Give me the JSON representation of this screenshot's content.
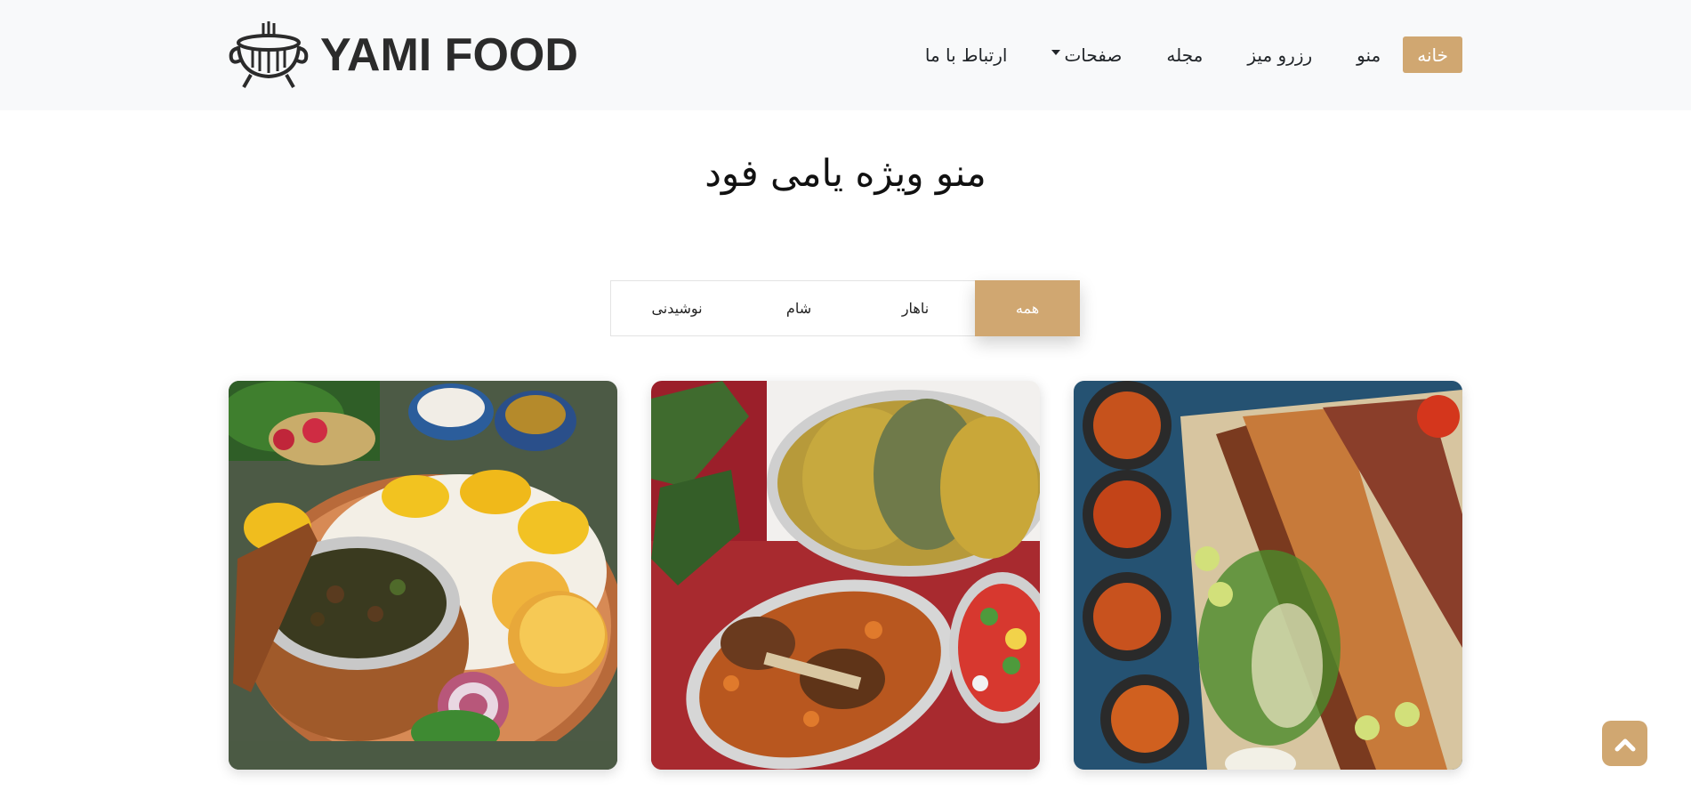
{
  "brand": {
    "name": "YAMI FOOD"
  },
  "nav": {
    "items": [
      {
        "label": "خانه",
        "active": true
      },
      {
        "label": "منو"
      },
      {
        "label": "رزرو میز"
      },
      {
        "label": "مجله"
      },
      {
        "label": "صفحات",
        "dropdown": true
      },
      {
        "label": "ارتباط با ما"
      }
    ]
  },
  "menu_section": {
    "title": "منو ویژه یامی فود",
    "filters": [
      {
        "label": "همه",
        "active": true
      },
      {
        "label": "ناهار"
      },
      {
        "label": "شام"
      },
      {
        "label": "نوشیدنی"
      }
    ],
    "cards": [
      {
        "image": "kebab-platter-photo"
      },
      {
        "image": "rice-and-lamb-shank-photo"
      },
      {
        "image": "ghormeh-sabzi-with-saffron-rice-photo"
      }
    ]
  },
  "colors": {
    "accent": "#d0a771",
    "header_bg": "#f8f9fa"
  },
  "icons": {
    "logo": "grill-pot-icon",
    "back_to_top": "chevron-up-icon"
  }
}
